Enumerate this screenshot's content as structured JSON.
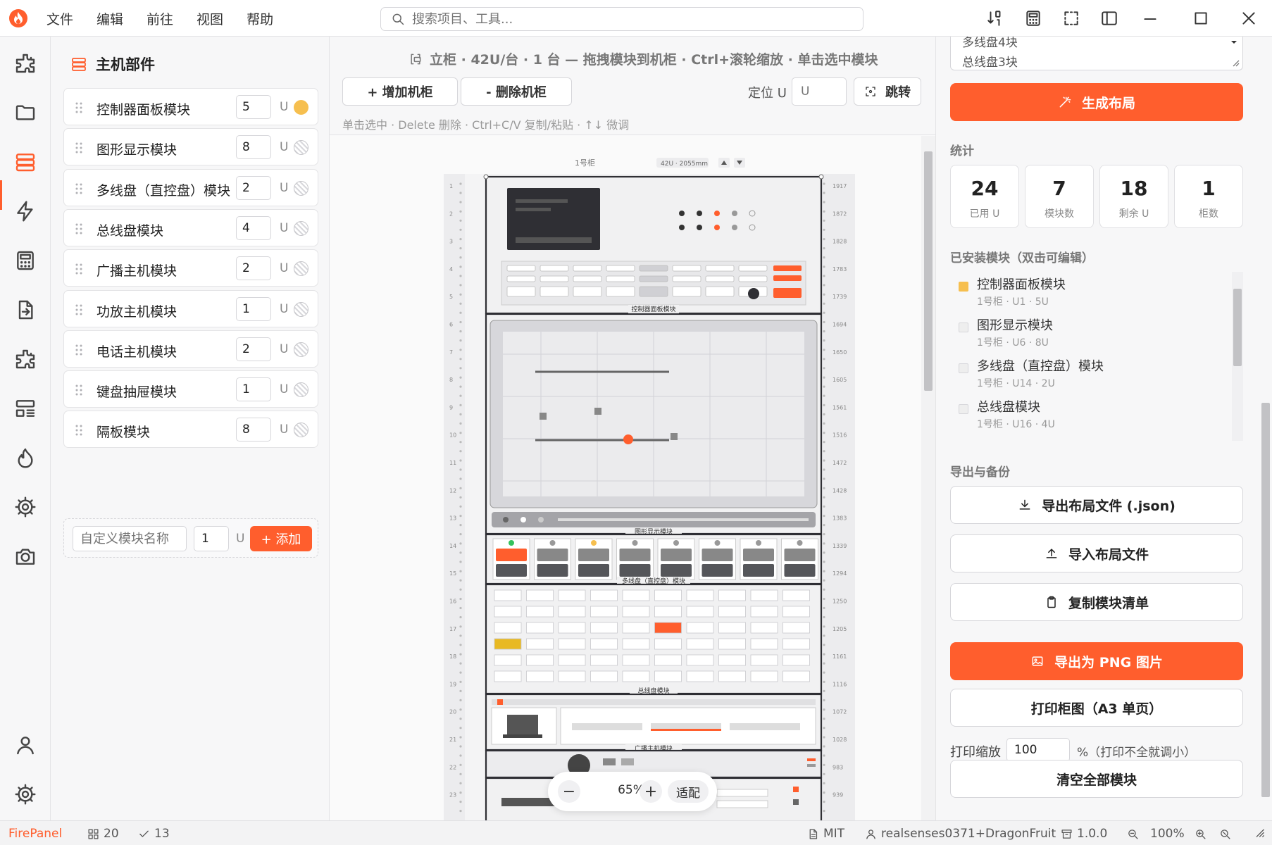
{
  "app": {
    "name": "FirePanel",
    "brand_color": "#ff5e2d"
  },
  "menu": [
    "文件",
    "编辑",
    "前往",
    "视图",
    "帮助"
  ],
  "search": {
    "placeholder": "搜索项目、工具..."
  },
  "left_panel": {
    "title": "主机部件",
    "parts": [
      {
        "name": "控制器面板模块",
        "units": "5",
        "unit_label": "U",
        "active": true
      },
      {
        "name": "图形显示模块",
        "units": "8",
        "unit_label": "U",
        "active": false
      },
      {
        "name": "多线盘（直控盘）模块",
        "units": "2",
        "unit_label": "U",
        "active": false
      },
      {
        "name": "总线盘模块",
        "units": "4",
        "unit_label": "U",
        "active": false
      },
      {
        "name": "广播主机模块",
        "units": "2",
        "unit_label": "U",
        "active": false
      },
      {
        "name": "功放主机模块",
        "units": "1",
        "unit_label": "U",
        "active": false
      },
      {
        "name": "电话主机模块",
        "units": "2",
        "unit_label": "U",
        "active": false
      },
      {
        "name": "键盘抽屉模块",
        "units": "1",
        "unit_label": "U",
        "active": false
      },
      {
        "name": "隔板模块",
        "units": "8",
        "unit_label": "U",
        "active": false
      }
    ],
    "custom": {
      "placeholder": "自定义模块名称",
      "units": "1",
      "unit_label": "U",
      "add_label": "+ 添加"
    }
  },
  "center": {
    "title": "立柜 · 42U/台 · 1 台 — 拖拽模块到机柜 · Ctrl+滚轮缩放 · 单击选中模块",
    "add_cabinet": "+ 增加机柜",
    "delete_cabinet": "- 删除机柜",
    "locate_label": "定位 U",
    "locate_placeholder": "U",
    "jump_label": "跳转",
    "hint": "单击选中 · Delete 删除 · Ctrl+C/V 复制/粘贴 · ↑↓ 微调",
    "zoom": {
      "value": "65%",
      "minus": "−",
      "plus": "+",
      "fit": "适配"
    }
  },
  "rack": {
    "name": "1号柜",
    "spec": "42U · 2055mm",
    "u_labels": [
      "1",
      "2",
      "3",
      "4",
      "5",
      "6",
      "7",
      "8",
      "9",
      "10",
      "11",
      "12",
      "13",
      "14",
      "15",
      "16",
      "17",
      "18",
      "19",
      "20",
      "21",
      "22",
      "23"
    ],
    "mm_labels": [
      "1917",
      "1872",
      "1828",
      "1783",
      "1739",
      "1694",
      "1650",
      "1605",
      "1561",
      "1516",
      "1472",
      "1428",
      "1383",
      "1339",
      "1294",
      "1250",
      "1205",
      "1161",
      "1116",
      "1072",
      "1028",
      "983",
      "939"
    ],
    "modules": [
      "控制器面板模块",
      "图形显示模块",
      "多线盘（直控盘）模块",
      "总线盘模块",
      "广播主机模块"
    ]
  },
  "right_panel": {
    "layout_list": [
      "多线盘4块",
      "总线盘3块"
    ],
    "generate": "生成布局",
    "stats_title": "统计",
    "stats": [
      {
        "value": "24",
        "label": "已用 U"
      },
      {
        "value": "7",
        "label": "模块数"
      },
      {
        "value": "18",
        "label": "剩余 U"
      },
      {
        "value": "1",
        "label": "柜数"
      }
    ],
    "installed_title": "已安装模块（双击可编辑）",
    "installed": [
      {
        "name": "控制器面板模块",
        "detail": "1号柜 · U1 · 5U",
        "active": true
      },
      {
        "name": "图形显示模块",
        "detail": "1号柜 · U6 · 8U",
        "active": false
      },
      {
        "name": "多线盘（直控盘）模块",
        "detail": "1号柜 · U14 · 2U",
        "active": false
      },
      {
        "name": "总线盘模块",
        "detail": "1号柜 · U16 · 4U",
        "active": false
      }
    ],
    "export_title": "导出与备份",
    "export_json": "导出布局文件 (.json)",
    "import": "导入布局文件",
    "copy_list": "复制模块清单",
    "export_png": "导出为 PNG 图片",
    "print": "打印柜图（A3 单页）",
    "print_zoom_label": "打印缩放",
    "print_zoom_value": "100",
    "print_zoom_hint": "%（打印不全就调小）",
    "clear": "清空全部模块"
  },
  "status": {
    "brand": "FirePanel",
    "items_count": "20",
    "checks_count": "13",
    "license": "MIT",
    "user": "realsenses0371+DragonFruit",
    "version": "1.0.0",
    "zoom": "100%"
  }
}
